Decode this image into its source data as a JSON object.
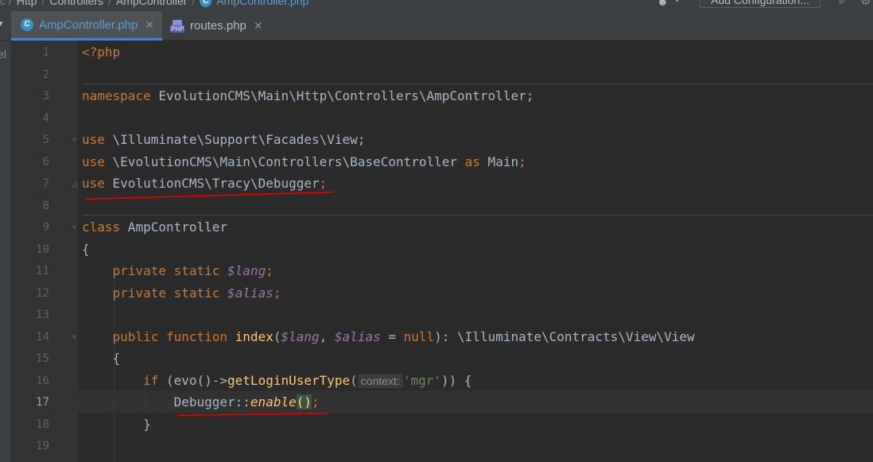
{
  "navbar": {
    "breadcrumbs": [
      "Http",
      "Controllers",
      "AmpController"
    ],
    "file_crumb": "AmpController.php",
    "add_configuration": "Add Configuration..."
  },
  "tabs": [
    {
      "label": "AmpController.php",
      "icon": "php-class-icon",
      "active": true
    },
    {
      "label": "routes.php",
      "icon": "php-file-icon",
      "active": false
    }
  ],
  "project_panel": {
    "label": "el"
  },
  "editor": {
    "current_line": 17,
    "line_numbers": [
      "1",
      "2",
      "3",
      "4",
      "5",
      "6",
      "7",
      "8",
      "9",
      "10",
      "11",
      "12",
      "13",
      "14",
      "15",
      "16",
      "17",
      "18",
      "19"
    ],
    "code": {
      "l1": "<?php",
      "l3_kw": "namespace",
      "l3_rest": " EvolutionCMS\\Main\\Http\\Controllers\\AmpController;",
      "l5_kw": "use",
      "l5_rest": " \\Illuminate\\Support\\Facades\\View;",
      "l6_kw": "use",
      "l6_path": " \\EvolutionCMS\\Main\\Controllers\\BaseController ",
      "l6_as": "as",
      "l6_alias": " Main",
      "l6_semi": ";",
      "l7_kw": "use",
      "l7_path": " EvolutionCMS\\Tracy\\Debugger",
      "l7_semi": ";",
      "l9_kw": "class",
      "l9_name": " AmpController",
      "l10": "{",
      "l11_kw": "    private static ",
      "l11_var": "$lang",
      "l11_semi": ";",
      "l12_kw": "    private static ",
      "l12_var": "$alias",
      "l12_semi": ";",
      "l14_kw": "    public function ",
      "l14_fn": "index",
      "l14_p1": "(",
      "l14_v1": "$lang",
      "l14_p2": ", ",
      "l14_v2": "$alias",
      "l14_p3": " = ",
      "l14_null": "null",
      "l14_p4": "): \\Illuminate\\Contracts\\View\\View",
      "l15": "    {",
      "l16_kw": "        if",
      "l16_p1": " (evo()->",
      "l16_fn": "getLoginUserType",
      "l16_p2": "(",
      "l16_hint": "context:",
      "l16_str": "'mgr'",
      "l16_p3": ")) {",
      "l17_cls": "            Debugger",
      "l17_op": "::",
      "l17_fn": "enable",
      "l17_br": "()",
      "l17_semi": ";",
      "l18": "        }"
    }
  },
  "colors": {
    "background": "#2b2b2b",
    "keyword": "#cc7832",
    "function": "#ffc66d",
    "variable": "#9876aa",
    "string": "#6a8759",
    "annotation_underline": "#e00000"
  }
}
